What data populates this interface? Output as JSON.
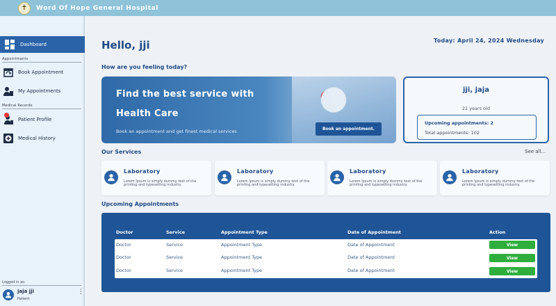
{
  "app": {
    "title": "Word Of Hope General Hospital",
    "logo_icon": "cross-logo-icon"
  },
  "sidebar": {
    "dashboard_label": "Dashboard",
    "section_appointments": "Appointments",
    "book_appointment": "Book Appointment",
    "my_appointments": "My Appointments",
    "section_medical_records": "Medical Records",
    "patient_profile": "Patient Profile",
    "medical_history": "Medical History",
    "logged_in_label": "Logged in as:",
    "user_name": "jaja jji",
    "user_role": "Patient"
  },
  "main": {
    "greeting": "Hello, jji",
    "today": "Today: April 24, 2024 Wednesday",
    "feeling_prompt": "How are you feeling today?"
  },
  "hero": {
    "title_line1": "Find the best service with",
    "title_line2": "Health Care",
    "subtitle": "Book an appointment and get finest medical services",
    "button_label": "Book an appointment."
  },
  "profile": {
    "name": "jji, jaja",
    "age": "21 years old",
    "upcoming": "Upcoming appointments: 2",
    "total": "Total appointments: 102"
  },
  "services": {
    "title": "Our Services",
    "see_all": "See all...",
    "items": [
      {
        "title": "Laboratory",
        "desc": "Lorem Ipsum is simply dummy text of the printing and typesetting industry."
      },
      {
        "title": "Laboratory",
        "desc": "Lorem Ipsum is simply dummy text of the printing and typesetting industry."
      },
      {
        "title": "Laboratory",
        "desc": "Lorem Ipsum is simply dummy text of the printing and typesetting industry."
      },
      {
        "title": "Laboratory",
        "desc": "Lorem Ipsum is simply dummy text of the printing and typesetting industry."
      }
    ]
  },
  "appointments": {
    "title": "Upcoming Appointments",
    "headers": [
      "Doctor",
      "Service",
      "Appointment Type",
      "Date of Appointment",
      "Action"
    ],
    "rows": [
      {
        "doctor": "Doctor",
        "service": "Service",
        "type": "Appointment Type",
        "date": "Date of Appointment",
        "action": "View"
      },
      {
        "doctor": "Doctor",
        "service": "Service",
        "type": "Appointment Type",
        "date": "Date of Appointment",
        "action": "View"
      },
      {
        "doctor": "Doctor",
        "service": "Service",
        "type": "Appointment Type",
        "date": "Date of Appointment",
        "action": "View"
      }
    ]
  },
  "colors": {
    "primary": "#2a63a8",
    "dark_primary": "#1f5597",
    "topbar": "#8ec3d9",
    "view_button": "#2fae3e",
    "badge": "#e53935"
  }
}
